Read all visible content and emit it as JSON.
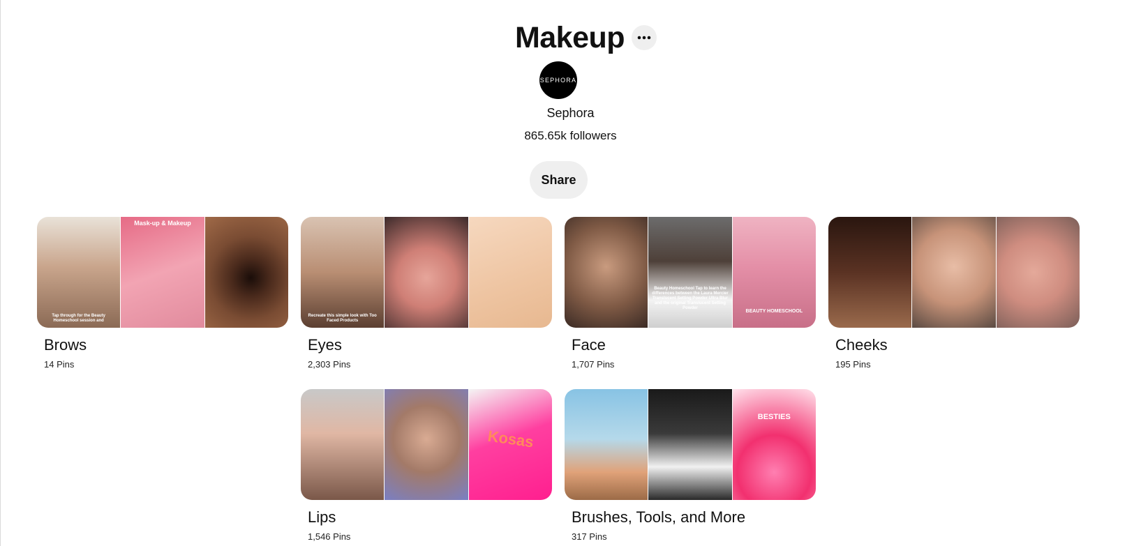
{
  "board": {
    "title": "Makeup",
    "owner_name": "Sephora",
    "owner_avatar_text": "SEPHORA",
    "followers": "865.65k followers",
    "share_label": "Share"
  },
  "icons": {
    "more": "ellipsis-icon"
  },
  "sections": [
    {
      "title": "Brows",
      "count": "14 Pins",
      "captions": [
        "Tap through for the Beauty Homeschool session and",
        "Mask-up & Makeup",
        ""
      ]
    },
    {
      "title": "Eyes",
      "count": "2,303 Pins",
      "captions": [
        "Recreate this simple look with Too Faced Products",
        "",
        ""
      ]
    },
    {
      "title": "Face",
      "count": "1,707 Pins",
      "captions": [
        "",
        "Beauty Homeschool Tap to learn the differences between the Laura Mercier Translucent Setting Powder Ultra Blur and the original Translucent Setting Powder",
        "BEAUTY HOMESCHOOL"
      ]
    },
    {
      "title": "Cheeks",
      "count": "195 Pins",
      "captions": [
        "",
        "",
        ""
      ]
    },
    {
      "title": "Lips",
      "count": "1,546 Pins",
      "captions": [
        "",
        "",
        "Kosas"
      ]
    },
    {
      "title": "Brushes, Tools, and More",
      "count": "317 Pins",
      "captions": [
        "",
        "",
        "BESTIES"
      ]
    }
  ]
}
